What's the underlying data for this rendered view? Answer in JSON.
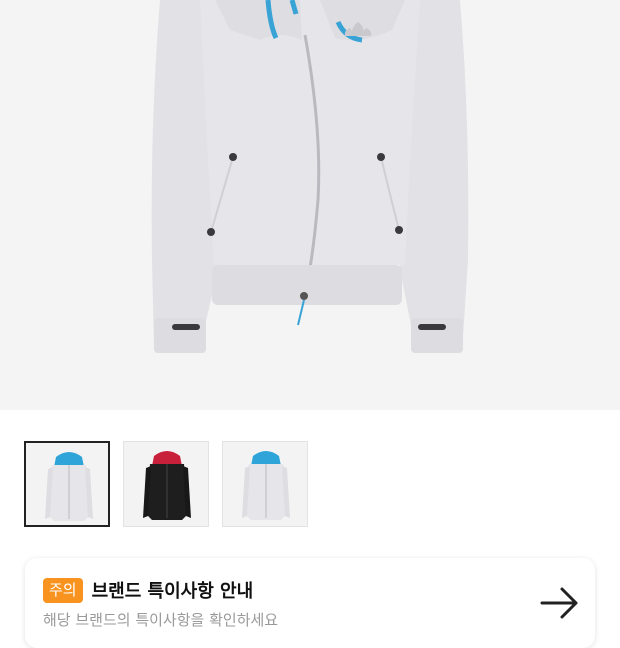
{
  "product_image": {
    "alt_subject": "light grey zip hoodie",
    "hood_lining_color": "#3aa3d6",
    "body_color": "#e4e4e8",
    "icon": "trefoil-logo-icon"
  },
  "thumbnails": [
    {
      "label": "",
      "variant": "grey-blue-lining",
      "body_color": "#e6e6ea",
      "hood_color": "#2fa4d8",
      "selected": true
    },
    {
      "label": "",
      "variant": "black-red-lining",
      "body_color": "#1e1e1e",
      "hood_color": "#c8203a",
      "selected": false
    },
    {
      "label": "",
      "variant": "grey-blue-lining",
      "body_color": "#e6e6ea",
      "hood_color": "#2fa4d8",
      "selected": false
    }
  ],
  "notice": {
    "badge": "주의",
    "title": "브랜드 특이사항 안내",
    "subtitle": "해당 브랜드의 특이사항을 확인하세요",
    "arrow_icon": "arrow-right-icon",
    "badge_color": "#f7931e"
  }
}
